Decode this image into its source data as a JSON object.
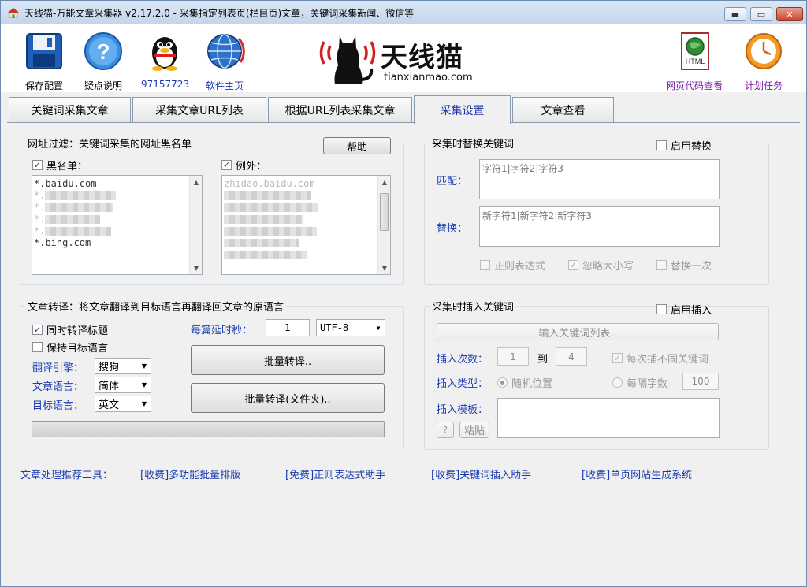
{
  "title_bar": {
    "title": "天线猫-万能文章采集器 v2.17.2.0 - 采集指定列表页(栏目页)文章，关键词采集新闻、微信等",
    "minimize_glyph": "▬",
    "maximize_glyph": "▭",
    "close_glyph": "✕"
  },
  "toolbar": {
    "save_label": "保存配置",
    "help_label": "疑点说明",
    "qq_label": "97157723",
    "home_label": "软件主页",
    "logo_cn": "天线猫",
    "logo_en": "tianxianmao.com",
    "html_label": "网页代码查看",
    "schedule_label": "计划任务"
  },
  "tabs": [
    {
      "label": "关键词采集文章"
    },
    {
      "label": "采集文章URL列表"
    },
    {
      "label": "根据URL列表采集文章"
    },
    {
      "label": "采集设置"
    },
    {
      "label": "文章查看"
    }
  ],
  "url_filter": {
    "title": "网址过滤：关键词采集的网址黑名单",
    "help_button": "帮助",
    "blacklist_label": "黑名单：",
    "exception_label": "例外：",
    "blacklist_lines": [
      "*.baidu.com",
      "*.",
      "*.",
      "*.",
      "*.",
      "*.bing.com"
    ],
    "exception_lines": [
      "zhidao.baidu.com"
    ]
  },
  "replace": {
    "title": "采集时替换关键词",
    "enable_label": "启用替换",
    "match_label": "匹配：",
    "match_value": "字符1|字符2|字符3",
    "replace_label": "替换：",
    "replace_value": "新字符1|新字符2|新字符3",
    "regex_label": "正则表达式",
    "ignore_case_label": "忽略大小写",
    "replace_once_label": "替换一次"
  },
  "translate": {
    "title": "文章转译：将文章翻译到目标语言再翻译回文章的原语言",
    "sync_title_label": "同时转译标题",
    "keep_target_label": "保持目标语言",
    "delay_label": "每篇延时秒：",
    "delay_value": "1",
    "encoding_value": "UTF-8",
    "engine_label": "翻译引擎：",
    "engine_value": "搜狗",
    "source_lang_label": "文章语言：",
    "source_lang_value": "简体",
    "target_lang_label": "目标语言：",
    "target_lang_value": "英文",
    "batch_button": "批量转译..",
    "batch_folder_button": "批量转译(文件夹).."
  },
  "insert": {
    "title": "采集时插入关键词",
    "enable_label": "启用插入",
    "keyword_list_button": "输入关键词列表..",
    "count_label": "插入次数：",
    "count_from": "1",
    "to_label": "到",
    "count_to": "4",
    "distinct_label": "每次插不同关键词",
    "type_label": "插入类型：",
    "random_label": "随机位置",
    "every_label": "每隔字数",
    "every_value": "100",
    "template_label": "插入模板：",
    "q_button": "?",
    "paste_button": "粘贴"
  },
  "tools": {
    "label": "文章处理推荐工具：",
    "links": [
      "[收费]多功能批量排版",
      "[免费]正则表达式助手",
      "[收费]关键词插入助手",
      "[收费]单页网站生成系统"
    ]
  },
  "colors": {
    "accent_blue": "#1a3cb0",
    "link_purple": "#7a1fa6",
    "logo_red": "#d51f1f"
  }
}
